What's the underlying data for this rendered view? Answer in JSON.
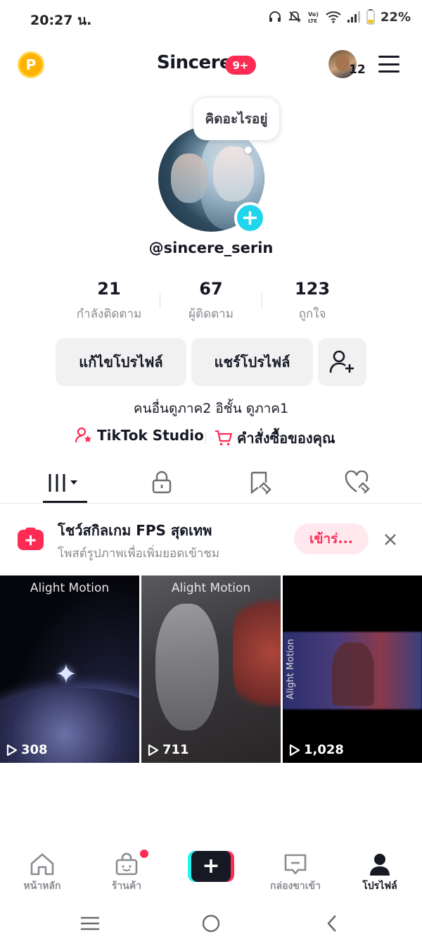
{
  "status_bar": {
    "time": "20:27 น.",
    "battery": "22%",
    "icons": [
      "headphones-icon",
      "mute-icon",
      "volte-icon",
      "wifi-icon",
      "signal-icon",
      "battery-icon"
    ]
  },
  "header": {
    "coin_letter": "P",
    "title": "Sincere",
    "badge": "9+",
    "friend_count": "12"
  },
  "profile": {
    "note": "คิดอะไรอยู่",
    "handle": "@sincere_serin",
    "stats": [
      {
        "value": "21",
        "label": "กำลังติดตาม"
      },
      {
        "value": "67",
        "label": "ผู้ติดตาม"
      },
      {
        "value": "123",
        "label": "ถูกใจ"
      }
    ],
    "edit_profile": "แก้ไขโปรไฟล์",
    "share_profile": "แชร์โปรไฟล์",
    "bio": "คนอื่นดูภาค2 อิชั้น ดูภาค1",
    "studio_link": "TikTok Studio",
    "orders_link": "คำสั่งซื้อของคุณ"
  },
  "tabs": [
    "videos-grid-icon",
    "lock-icon",
    "repost-icon",
    "liked-heart-icon"
  ],
  "promo": {
    "title": "โชว์สกิลเกม FPS สุดเทพ",
    "subtitle": "โพสต์รูปภาพเพื่อเพิ่มยอดเข้าชม",
    "join": "เข้าร่..."
  },
  "videos": [
    {
      "watermark": "Alight Motion",
      "views": "308"
    },
    {
      "watermark": "Alight Motion",
      "views": "711"
    },
    {
      "watermark": "Alight Motion",
      "views": "1,028"
    }
  ],
  "bottom_nav": {
    "home": "หน้าหลัก",
    "shop": "ร้านค้า",
    "create": "+",
    "inbox": "กล่องขาเข้า",
    "profile": "โปรไฟล์"
  },
  "colors": {
    "accent": "#fe2c55",
    "cyan": "#25f4ee",
    "text": "#161823",
    "muted": "#8a8b91"
  }
}
